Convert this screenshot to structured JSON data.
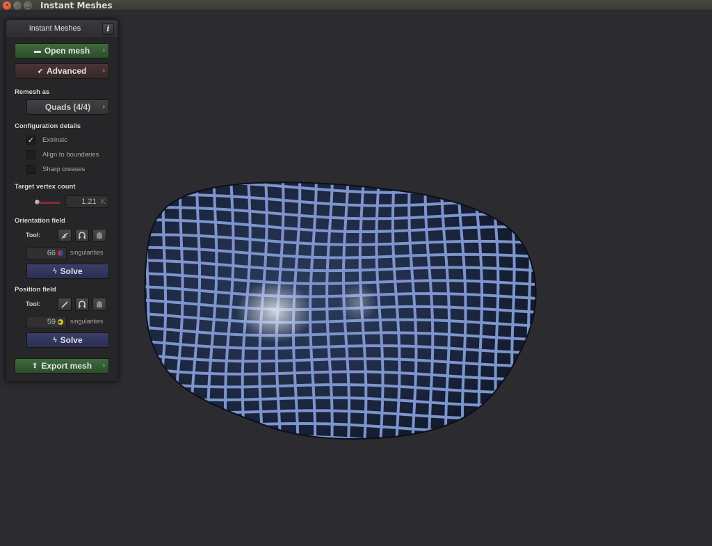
{
  "window": {
    "title": "Instant Meshes"
  },
  "panel": {
    "title": "Instant Meshes",
    "info_label": "i",
    "open_mesh_label": "Open mesh",
    "advanced_label": "Advanced",
    "remesh_as_label": "Remesh as",
    "remesh_mode": "Quads (4/4)",
    "config_label": "Configuration details",
    "checkboxes": [
      {
        "label": "Extrinsic",
        "checked": true,
        "mark": "✓"
      },
      {
        "label": "Align to boundaries",
        "checked": false,
        "mark": ""
      },
      {
        "label": "Sharp creases",
        "checked": false,
        "mark": ""
      }
    ],
    "target_vertex_label": "Target vertex count",
    "target_vertex_value": "1.21",
    "target_vertex_unit": "K",
    "target_vertex_slider": 0.3,
    "orientation_label": "Orientation field",
    "orientation_tool_label": "Tool:",
    "orientation_singularities": "66",
    "singularities_label": "singularities",
    "orientation_solve_label": "Solve",
    "position_label": "Position field",
    "position_tool_label": "Tool:",
    "position_singularities": "59",
    "position_solve_label": "Solve",
    "export_mesh_label": "Export mesh"
  },
  "colors": {
    "mesh_fill": "#1c2740",
    "mesh_grid": "#7d94cc",
    "accent_green": "#3f6a3c",
    "accent_blue": "#3a3e6a"
  },
  "icons": {
    "open": "folder-icon",
    "advanced": "rocket-icon",
    "chevron": "chevron-right-icon",
    "solve": "bolt-icon",
    "export": "export-icon"
  }
}
